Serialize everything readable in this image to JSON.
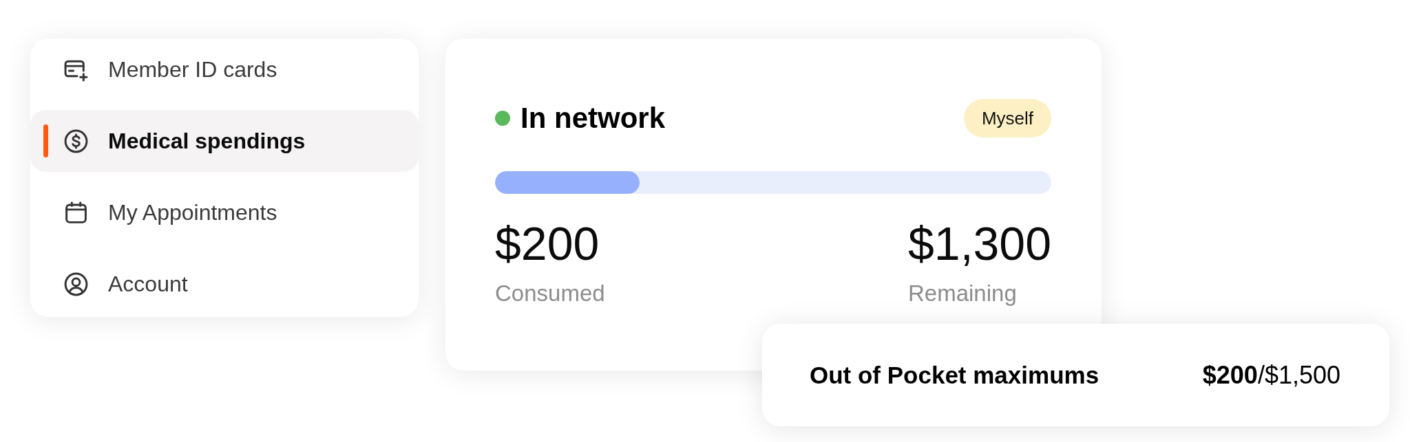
{
  "sidebar": {
    "items": [
      {
        "label": "Member ID cards",
        "selected": false
      },
      {
        "label": "Medical spendings",
        "selected": true
      },
      {
        "label": "My Appointments",
        "selected": false
      },
      {
        "label": "Account",
        "selected": false
      }
    ]
  },
  "coverage_card": {
    "title": "In network",
    "color": "#5cb85c",
    "badge": "Myself",
    "progress": {
      "level": 0.26
    },
    "consumed": {
      "amount": "$200",
      "label": "Consumed"
    },
    "remaining": {
      "amount": "$1,300",
      "label": "Remaining"
    }
  },
  "out_of_pocket": {
    "label": "Out of Pocket maximums",
    "value": "**$200**/$1,500"
  }
}
